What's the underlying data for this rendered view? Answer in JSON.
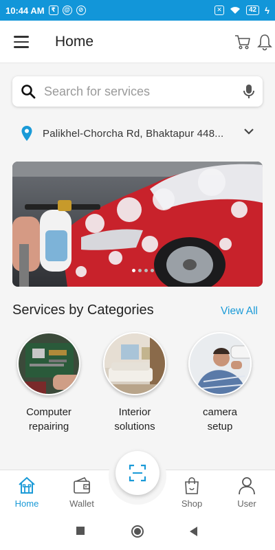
{
  "status_bar": {
    "time": "10:44 AM",
    "battery": "42"
  },
  "app_bar": {
    "title": "Home"
  },
  "search": {
    "placeholder": "Search for services"
  },
  "location": {
    "address": "Palikhel-Chorcha Rd, Bhaktapur 448..."
  },
  "banner": {
    "slide_count": 4,
    "active_slide": 1
  },
  "categories_section": {
    "title": "Services by Categories",
    "view_all": "View All",
    "items": [
      {
        "line1": "Computer",
        "line2": "repairing"
      },
      {
        "line1": "Interior",
        "line2": "solutions"
      },
      {
        "line1": "camera",
        "line2": "setup"
      }
    ]
  },
  "bottom_nav": {
    "items": [
      {
        "label": "Home",
        "icon": "home-icon",
        "active": true
      },
      {
        "label": "Wallet",
        "icon": "wallet-icon",
        "active": false
      },
      {
        "label": "Shop",
        "icon": "shop-bag-icon",
        "active": false
      },
      {
        "label": "User",
        "icon": "user-icon",
        "active": false
      }
    ],
    "center_action_icon": "scan-icon"
  },
  "colors": {
    "primary": "#1a9ad7",
    "status_bar": "#1296d9"
  }
}
